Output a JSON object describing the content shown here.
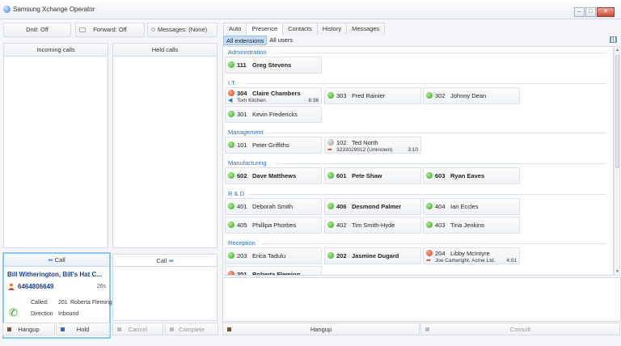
{
  "window": {
    "title": "Samsung Xchange Operator"
  },
  "toolbar": {
    "dnd": "Dnd: Off",
    "forward": "Forward: Off",
    "messages": "Messages: (None)"
  },
  "panels": {
    "incoming": "Incoming calls",
    "held": "Held calls"
  },
  "call": {
    "left_label": "Call",
    "right_label": "Call",
    "caller": "Bill Witherington, Bill's Hat C...",
    "number": "6464806649",
    "duration": "26s",
    "called_label": "Called:",
    "called_ext": "201",
    "called_name": "Roberta Fleming",
    "direction_label": "Direction",
    "direction_value": "Inbound"
  },
  "left_buttons": {
    "hangup": "Hangup",
    "hold": "Hold",
    "cancel": "Cancel",
    "complete": "Complete"
  },
  "tabs": [
    "Auto",
    "Presence",
    "Contacts",
    "History",
    "Messages"
  ],
  "subtabs": [
    "All extensions",
    "All users"
  ],
  "groups": [
    {
      "name": "Administration",
      "extensions": [
        {
          "ext": "111",
          "name": "Greg Stevens",
          "status": "green",
          "bold": true
        }
      ]
    },
    {
      "name": "I.T.",
      "extensions": [
        {
          "ext": "304",
          "name": "Claire Chambers",
          "status": "red",
          "bold": true,
          "sub": "Tom Kitchen",
          "sub_time": "8:38",
          "sub_dir": "in"
        },
        {
          "ext": "303",
          "name": "Fred Rainier",
          "status": "green"
        },
        {
          "ext": "302",
          "name": "Johnny Dean",
          "status": "green"
        },
        {
          "ext": "301",
          "name": "Kevin Fredericks",
          "status": "green"
        }
      ]
    },
    {
      "name": "Management",
      "extensions": [
        {
          "ext": "101",
          "name": "Peter Griffiths",
          "status": "green"
        },
        {
          "ext": "102",
          "name": "Ted North",
          "status": "grey",
          "sub": "3233029912  (Unknown)",
          "sub_time": "3:10",
          "sub_dir": "out"
        }
      ]
    },
    {
      "name": "Manufacturing",
      "extensions": [
        {
          "ext": "602",
          "name": "Dave Matthews",
          "status": "green",
          "bold": true
        },
        {
          "ext": "601",
          "name": "Pete Shaw",
          "status": "green",
          "bold": true
        },
        {
          "ext": "603",
          "name": "Ryan Eaves",
          "status": "green",
          "bold": true
        }
      ]
    },
    {
      "name": "R & D",
      "extensions": [
        {
          "ext": "401",
          "name": "Deborah Smith",
          "status": "green"
        },
        {
          "ext": "406",
          "name": "Desmond Palmer",
          "status": "green",
          "bold": true
        },
        {
          "ext": "404",
          "name": "Ian Eccles",
          "status": "green"
        },
        {
          "ext": "405",
          "name": "Phillipa Phorbes",
          "status": "green"
        },
        {
          "ext": "402",
          "name": "Tim Smith-Hyde",
          "status": "green"
        },
        {
          "ext": "403",
          "name": "Tina Jenkins",
          "status": "green"
        }
      ]
    },
    {
      "name": "Reception",
      "extensions": [
        {
          "ext": "203",
          "name": "Erica Tadulu",
          "status": "green"
        },
        {
          "ext": "202",
          "name": "Jasmine Dugard",
          "status": "green",
          "bold": true
        },
        {
          "ext": "204",
          "name": "Libby McIntyre",
          "status": "red",
          "sub": "Joe Cartwright, Acme Ltd.",
          "sub_time": "4:01",
          "sub_dir": "out"
        },
        {
          "ext": "201",
          "name": "Roberta Fleming",
          "status": "red",
          "bold": true
        }
      ]
    }
  ],
  "right_buttons": {
    "hangup": "Hangup",
    "consult": "Consult"
  },
  "colors": {
    "accent": "#2f6fb2",
    "selected_tab": "#c7ddf3",
    "call_border": "#8cc7ef",
    "available": "#34a91e",
    "busy": "#d9411b"
  }
}
